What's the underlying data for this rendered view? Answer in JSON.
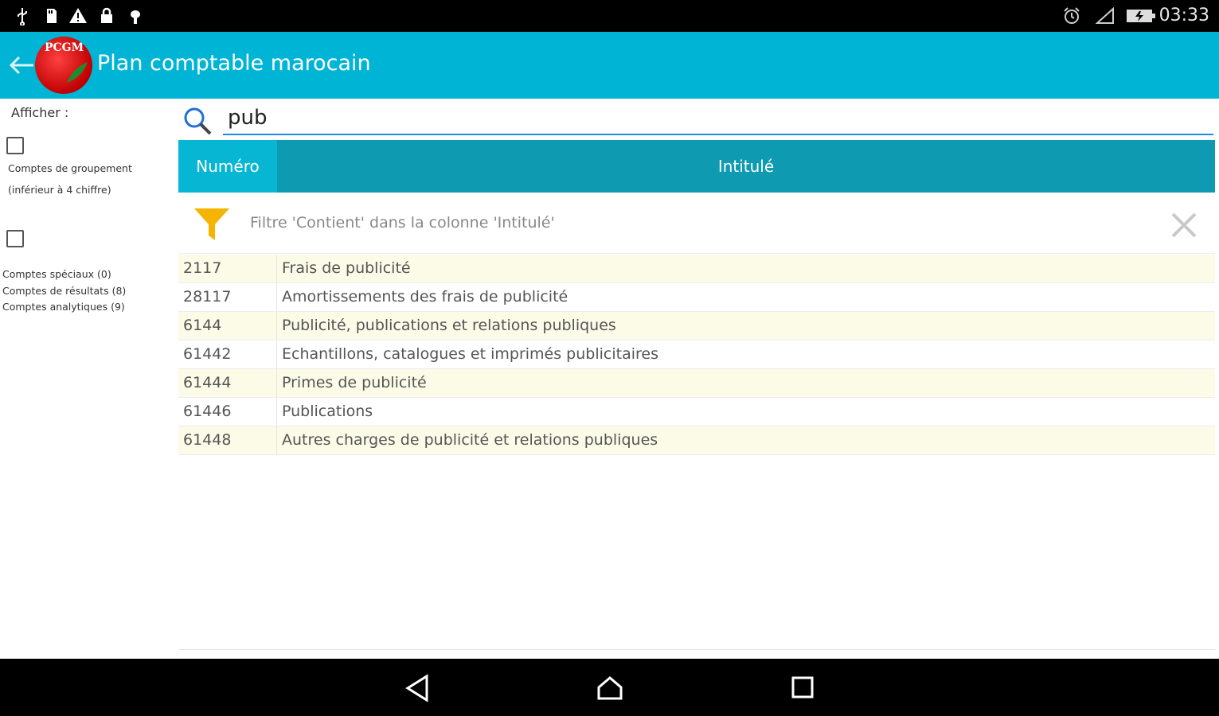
{
  "status_bar": {
    "time": "03:33",
    "left_icons": [
      "usb-icon",
      "sd-card-icon",
      "warning-icon",
      "lock-icon",
      "debug-icon"
    ],
    "right_icons": [
      "alarm-icon",
      "signal-icon",
      "battery-icon"
    ]
  },
  "app_bar": {
    "title": "Plan comptable marocain",
    "logo_text": "PCGM",
    "accent_color": "#00b4d6"
  },
  "sidebar": {
    "afficher_label": "Afficher :",
    "group_accounts_label_line1": "Comptes de groupement",
    "group_accounts_label_line2": "(inférieur à 4 chiffre)",
    "special_accounts_line1": "Comptes spéciaux (0)",
    "special_accounts_line2": "Comptes de résultats (8)",
    "special_accounts_line3": "Comptes analytiques (9)"
  },
  "search": {
    "value": "pub"
  },
  "table": {
    "header_color": "#0e9ab1",
    "columns": [
      "Numéro",
      "Intitulé"
    ],
    "filter_text": "Filtre 'Contient' dans la colonne 'Intitulé'",
    "rows": [
      {
        "numero": "2117",
        "intitule": "Frais de publicité"
      },
      {
        "numero": "28117",
        "intitule": "Amortissements des frais de publicité"
      },
      {
        "numero": "6144",
        "intitule": "Publicité, publications et relations publiques"
      },
      {
        "numero": "61442",
        "intitule": "Echantillons, catalogues et imprimés publicitaires"
      },
      {
        "numero": "61444",
        "intitule": "Primes de publicité"
      },
      {
        "numero": "61446",
        "intitule": "Publications"
      },
      {
        "numero": "61448",
        "intitule": "Autres charges de publicité et relations publiques"
      }
    ]
  }
}
